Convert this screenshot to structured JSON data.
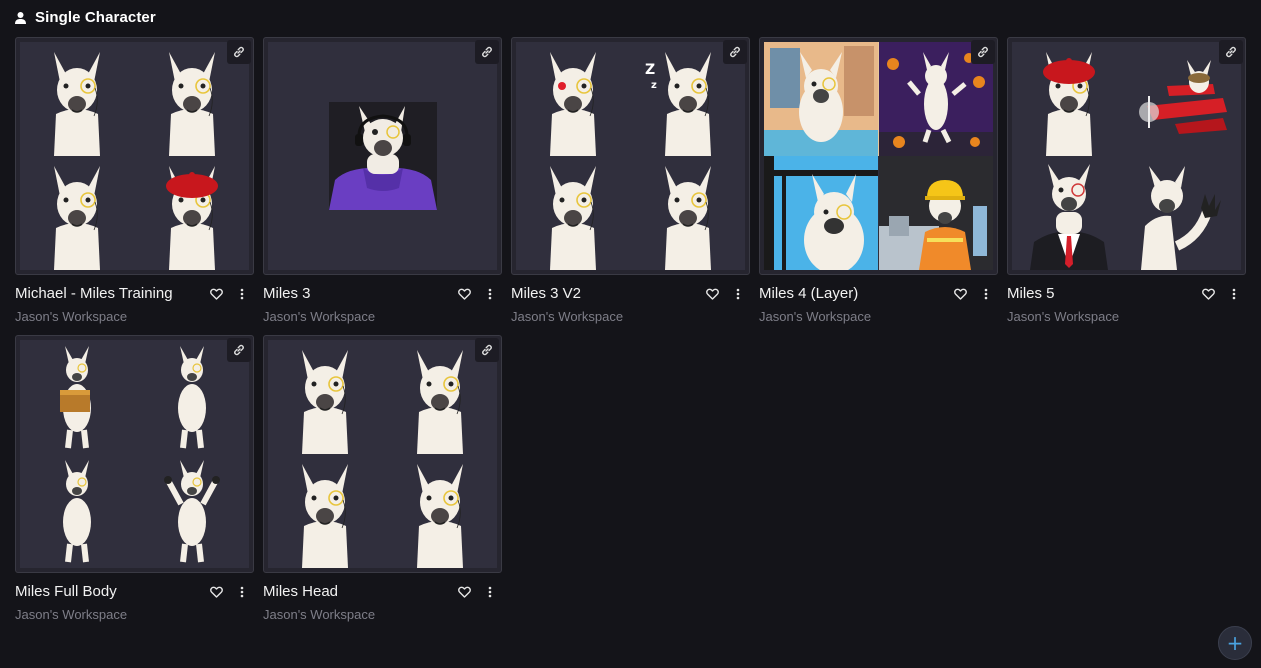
{
  "section": {
    "title": "Single Character",
    "icon": "user-icon"
  },
  "cards": [
    {
      "title": "Michael - Miles Training",
      "subtitle": "Jason's Workspace"
    },
    {
      "title": "Miles 3",
      "subtitle": "Jason's Workspace"
    },
    {
      "title": "Miles 3 V2",
      "subtitle": "Jason's Workspace"
    },
    {
      "title": "Miles 4 (Layer)",
      "subtitle": "Jason's Workspace"
    },
    {
      "title": "Miles 5",
      "subtitle": "Jason's Workspace"
    },
    {
      "title": "Miles Full Body",
      "subtitle": "Jason's Workspace"
    },
    {
      "title": "Miles Head",
      "subtitle": "Jason's Workspace"
    }
  ],
  "fab": {
    "label": "+",
    "icon": "plus-icon"
  },
  "colors": {
    "background": "#141419",
    "card_border": "#3a3a44",
    "thumb_bg": "#302f3d",
    "subtitle": "#7e7e88",
    "accent": "#4aa3e0"
  }
}
